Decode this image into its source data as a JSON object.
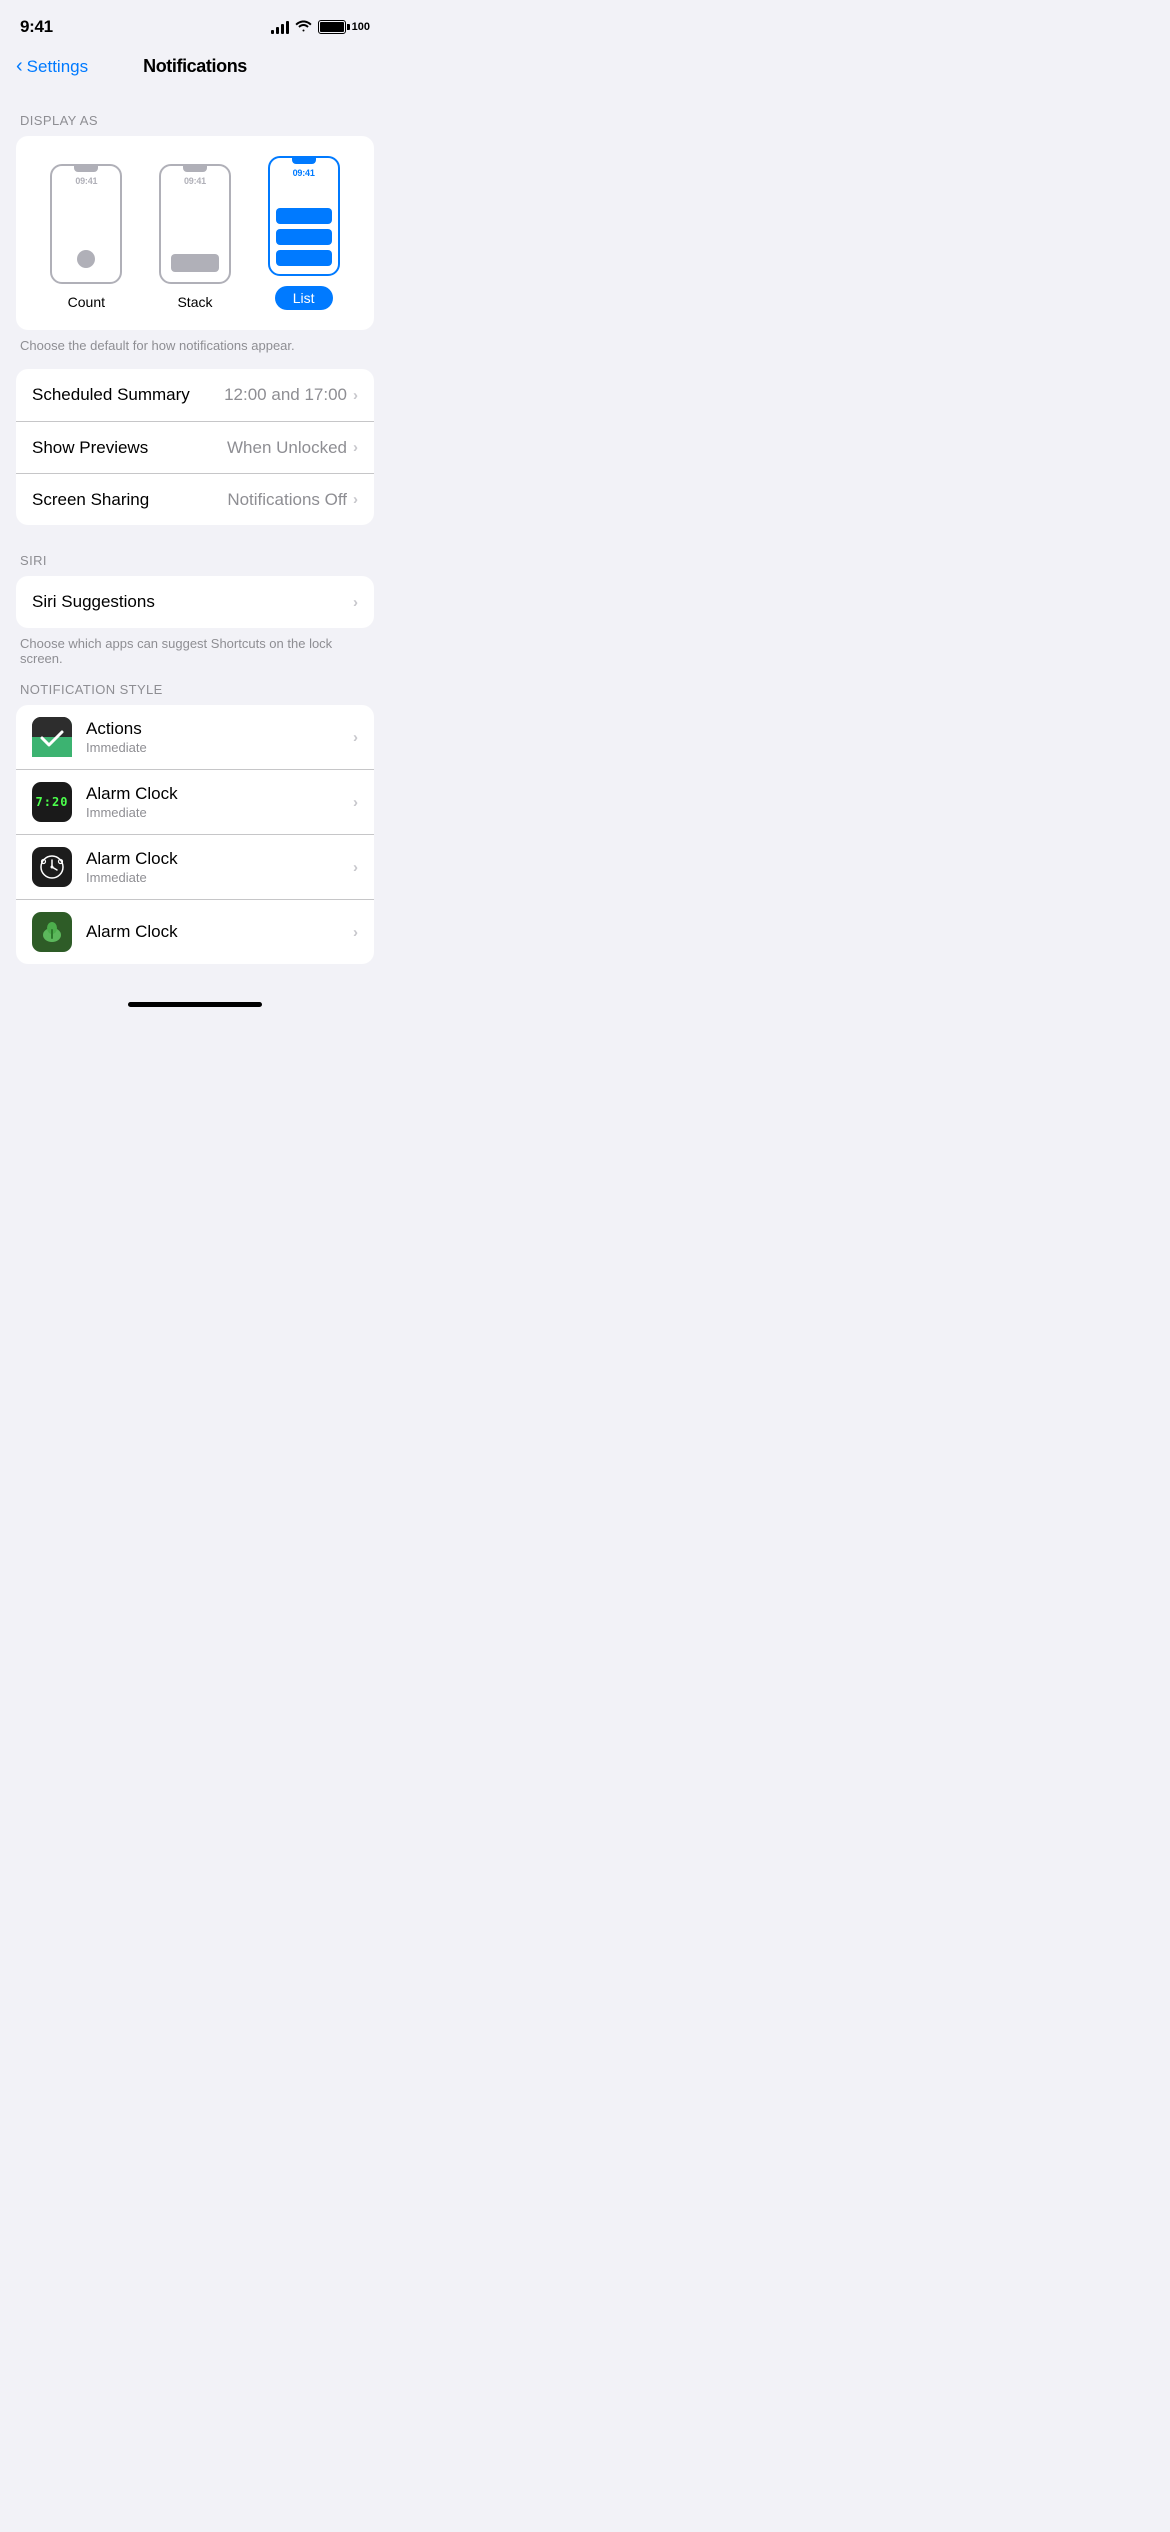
{
  "statusBar": {
    "time": "9:41",
    "battery": "100"
  },
  "nav": {
    "back": "Settings",
    "title": "Notifications"
  },
  "displayAs": {
    "sectionLabel": "DISPLAY AS",
    "options": [
      {
        "id": "count",
        "label": "Count",
        "selected": false
      },
      {
        "id": "stack",
        "label": "Stack",
        "selected": false
      },
      {
        "id": "list",
        "label": "List",
        "selected": true
      }
    ],
    "caption": "Choose the default for how notifications appear."
  },
  "settingsRows": [
    {
      "label": "Scheduled Summary",
      "value": "12:00 and 17:00"
    },
    {
      "label": "Show Previews",
      "value": "When Unlocked"
    },
    {
      "label": "Screen Sharing",
      "value": "Notifications Off"
    }
  ],
  "siriSection": {
    "label": "SIRI",
    "items": [
      {
        "label": "Siri Suggestions"
      }
    ],
    "caption": "Choose which apps can suggest Shortcuts on the lock screen."
  },
  "notificationStyle": {
    "label": "NOTIFICATION STYLE",
    "apps": [
      {
        "name": "Actions",
        "sub": "Immediate",
        "iconType": "actions"
      },
      {
        "name": "Alarm Clock",
        "sub": "Immediate",
        "iconType": "alarmclock1"
      },
      {
        "name": "Alarm Clock",
        "sub": "Immediate",
        "iconType": "alarmclock2"
      },
      {
        "name": "Alarm Clock",
        "sub": "",
        "iconType": "alarmclock3"
      }
    ]
  }
}
